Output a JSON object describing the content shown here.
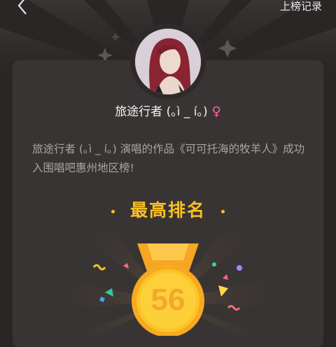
{
  "header": {
    "back_icon": "chevron-left-icon",
    "record_link": "上榜记录"
  },
  "profile": {
    "username": "旅途行者 (｡ì _ í｡)",
    "gender_icon": "female-icon",
    "gender_symbol": "♀",
    "gender_color": "#ff5fa0"
  },
  "description": "旅途行者 (｡ì _ í｡) 演唱的作品《可可托海的牧羊人》成功入围唱吧惠州地区榜!",
  "rank": {
    "title": "最高排名",
    "value": "56",
    "medal_icon": "gold-medal-icon"
  },
  "colors": {
    "background": "#2a2626",
    "card": "#393434",
    "accent": "#f8c024"
  }
}
